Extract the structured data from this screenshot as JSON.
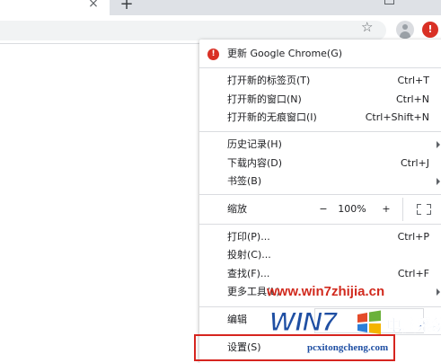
{
  "tabstrip": {
    "close_glyph": "×",
    "new_tab_glyph": "+"
  },
  "toolbar": {
    "star_glyph": "☆",
    "update_glyph": "!",
    "update_color": "#d93025"
  },
  "menu": {
    "update": {
      "label": "更新 Google Chrome(G)",
      "badge_glyph": "!"
    },
    "new_tab": {
      "label": "打开新的标签页(T)",
      "shortcut": "Ctrl+T"
    },
    "new_window": {
      "label": "打开新的窗口(N)",
      "shortcut": "Ctrl+N"
    },
    "incognito": {
      "label": "打开新的无痕窗口(I)",
      "shortcut": "Ctrl+Shift+N"
    },
    "history": {
      "label": "历史记录(H)"
    },
    "downloads": {
      "label": "下载内容(D)",
      "shortcut": "Ctrl+J"
    },
    "bookmarks": {
      "label": "书签(B)"
    },
    "zoom": {
      "label": "缩放",
      "minus": "−",
      "value": "100%",
      "plus": "+"
    },
    "print": {
      "label": "打印(P)...",
      "shortcut": "Ctrl+P"
    },
    "cast": {
      "label": "投射(C)..."
    },
    "find": {
      "label": "查找(F)...",
      "shortcut": "Ctrl+F"
    },
    "more_tools": {
      "label": "更多工具(L)"
    },
    "edit": {
      "label": "编辑"
    },
    "settings": {
      "label": "设置(S)"
    }
  },
  "watermark": {
    "url": "www.win7zhijia.cn",
    "logo_text": "WIN7",
    "brand": "电脑系统城",
    "sub": "pcxitongcheng.com"
  }
}
